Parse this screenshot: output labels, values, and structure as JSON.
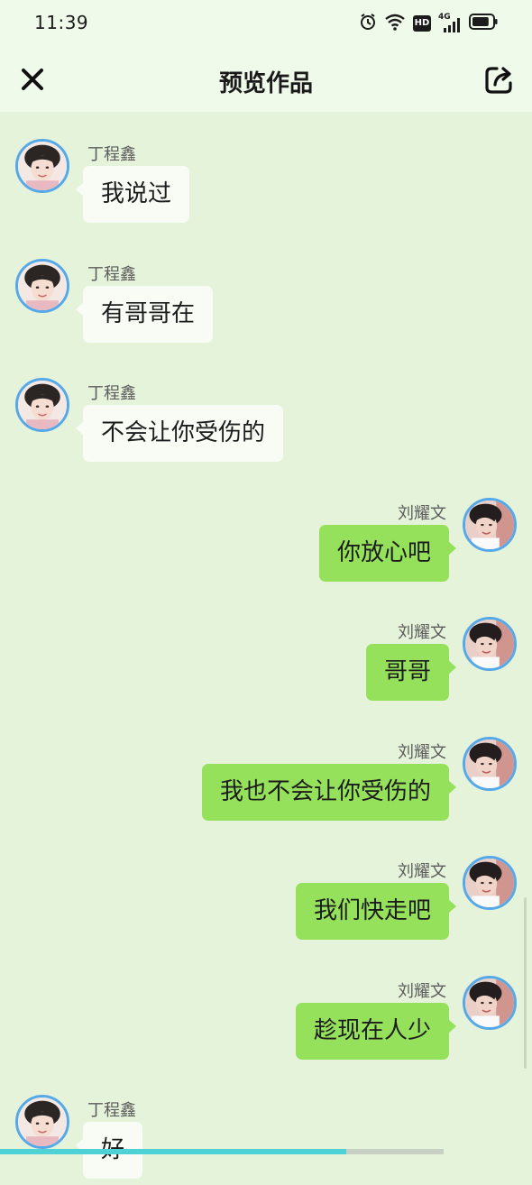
{
  "status": {
    "time": "11:39",
    "hd_label": "HD",
    "network_label": "4G",
    "battery_level": 0.85
  },
  "header": {
    "title": "预览作品"
  },
  "messages": [
    {
      "side": "left",
      "sender": "丁程鑫",
      "text": "我说过"
    },
    {
      "side": "left",
      "sender": "丁程鑫",
      "text": "有哥哥在"
    },
    {
      "side": "left",
      "sender": "丁程鑫",
      "text": "不会让你受伤的"
    },
    {
      "side": "right",
      "sender": "刘耀文",
      "text": "你放心吧"
    },
    {
      "side": "right",
      "sender": "刘耀文",
      "text": "哥哥"
    },
    {
      "side": "right",
      "sender": "刘耀文",
      "text": "我也不会让你受伤的"
    },
    {
      "side": "right",
      "sender": "刘耀文",
      "text": "我们快走吧"
    },
    {
      "side": "right",
      "sender": "刘耀文",
      "text": "趁现在人少"
    },
    {
      "side": "left",
      "sender": "丁程鑫",
      "text": "好"
    }
  ],
  "progress": {
    "value": 0.78
  },
  "colors": {
    "background": "#e5f3da",
    "bubble_left": "#f8fcf5",
    "bubble_right": "#95e15b",
    "avatar_border": "#56a9e9",
    "progress": "#4fd2d6"
  }
}
